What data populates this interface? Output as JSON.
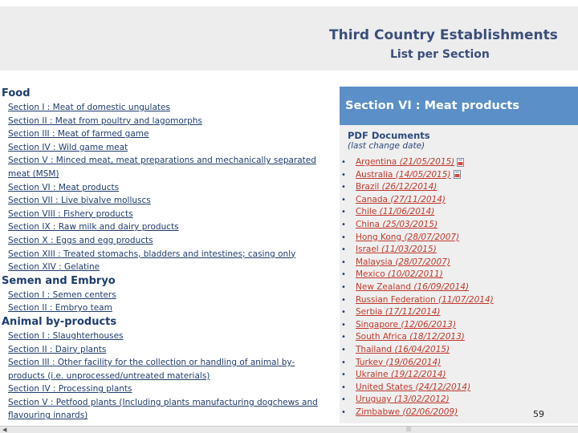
{
  "banner": {
    "title": "Third Country Establishments",
    "subtitle": "List per Section"
  },
  "left_panel": {
    "categories": [
      {
        "title": "Food",
        "links": [
          "Section I : Meat of domestic ungulates",
          "Section II : Meat from poultry and lagomorphs",
          "Section III : Meat of farmed game",
          "Section IV : Wild game meat",
          "Section V : Minced meat, meat preparations and mechanically separated meat (MSM)",
          "Section VI : Meat products",
          "Section VII : Live bivalve molluscs",
          "Section VIII : Fishery products",
          "Section IX : Raw milk and dairy products",
          "Section X : Eggs and egg products",
          "Section XIII : Treated stomachs, bladders and intestines; casing only",
          "Section XIV : Gelatine"
        ]
      },
      {
        "title": "Semen and Embryo",
        "links": [
          "Section I : Semen centers",
          "Section II : Embryo team"
        ]
      },
      {
        "title": "Animal by-products",
        "links": [
          "Section I : Slaughterhouses",
          "Section II : Dairy plants",
          "Section III : Other facility for the collection or handling of animal by-products (i.e. unprocessed/untreated materials)",
          "Section IV : Processing plants",
          "Section V : Petfood plants (Including plants manufacturing dogchews and flavouring innards)"
        ]
      }
    ]
  },
  "right_panel": {
    "section_title": "Section VI : Meat products",
    "pdf_title": "PDF Documents",
    "pdf_subtitle": "(last change date)",
    "countries": [
      {
        "name": "Argentina",
        "date": "(21/05/2015)",
        "icon": "pdf-icon"
      },
      {
        "name": "Australia",
        "date": "(14/05/2015)",
        "icon": "pdf-icon"
      },
      {
        "name": "Brazil",
        "date": "(26/12/2014)"
      },
      {
        "name": "Canada",
        "date": "(27/11/2014)"
      },
      {
        "name": "Chile",
        "date": "(11/06/2014)"
      },
      {
        "name": "China",
        "date": "(25/03/2015)"
      },
      {
        "name": "Hong Kong",
        "date": "(28/07/2007)"
      },
      {
        "name": "Israel",
        "date": "(11/03/2015)"
      },
      {
        "name": "Malaysia",
        "date": "(28/07/2007)"
      },
      {
        "name": "Mexico",
        "date": "(10/02/2011)"
      },
      {
        "name": "New Zealand",
        "date": "(16/09/2014)"
      },
      {
        "name": "Russian Federation",
        "date": "(11/07/2014)"
      },
      {
        "name": "Serbia",
        "date": "(17/11/2014)"
      },
      {
        "name": "Singapore",
        "date": "(12/06/2013)"
      },
      {
        "name": "South Africa",
        "date": "(18/12/2013)"
      },
      {
        "name": "Thailand",
        "date": "(16/04/2015)"
      },
      {
        "name": "Turkey",
        "date": "(19/06/2014)"
      },
      {
        "name": "Ukraine",
        "date": "(19/12/2014)"
      },
      {
        "name": "United States",
        "date": "(24/12/2014)"
      },
      {
        "name": "Uruguay",
        "date": "(13/02/2012)"
      },
      {
        "name": "Zimbabwe",
        "date": "(02/06/2009)"
      }
    ]
  },
  "page_number": "59",
  "colors": {
    "banner_bg": "#ededed",
    "section_header": "#5b8fc7",
    "link_blue": "#1f3d6e",
    "country_red": "#c0392b"
  }
}
